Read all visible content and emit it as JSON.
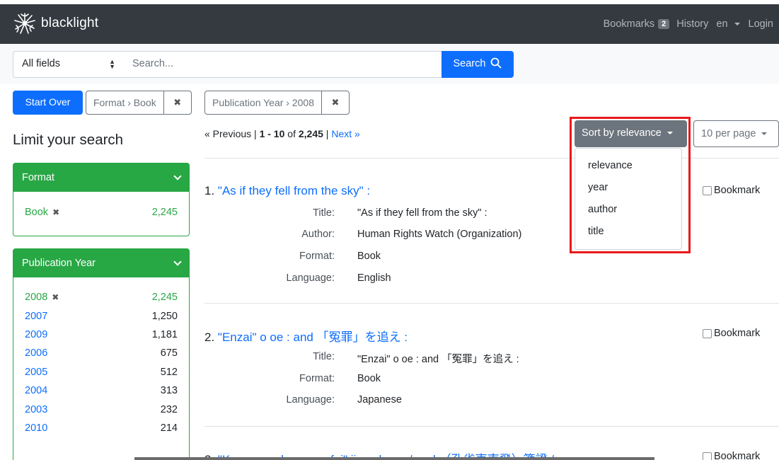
{
  "navbar": {
    "brand": "blacklight",
    "bookmarks_label": "Bookmarks",
    "bookmarks_count": "2",
    "history_label": "History",
    "language_label": "en",
    "login_label": "Login"
  },
  "search": {
    "field_selected": "All fields",
    "placeholder": "Search...",
    "button_label": "Search"
  },
  "constraints": {
    "start_over": "Start Over",
    "items": [
      {
        "label": "Format › Book",
        "remove": "✖"
      },
      {
        "label": "Publication Year › 2008",
        "remove": "✖"
      }
    ]
  },
  "sidebar": {
    "title": "Limit your search",
    "facets": [
      {
        "name": "Format",
        "items": [
          {
            "value": "Book",
            "count": "2,245",
            "selected": true
          }
        ]
      },
      {
        "name": "Publication Year",
        "items": [
          {
            "value": "2008",
            "count": "2,245",
            "selected": true
          },
          {
            "value": "2007",
            "count": "1,250"
          },
          {
            "value": "2009",
            "count": "1,181"
          },
          {
            "value": "2006",
            "count": "675"
          },
          {
            "value": "2005",
            "count": "512"
          },
          {
            "value": "2004",
            "count": "313"
          },
          {
            "value": "2003",
            "count": "232"
          },
          {
            "value": "2010",
            "count": "214"
          }
        ]
      }
    ]
  },
  "results_header": {
    "previous": "« Previous",
    "separator": "|",
    "range": "1 - 10",
    "of": "of",
    "total": "2,245",
    "next": "Next »",
    "sort_label": "Sort by relevance",
    "per_page_label": "10 per page",
    "sort_options": [
      "relevance",
      "year",
      "author",
      "title"
    ]
  },
  "results": [
    {
      "number": "1.",
      "title": "\"As if they fell from the sky\" :",
      "fields": [
        {
          "label": "Title:",
          "value": "\"As if they fell from the sky\" :"
        },
        {
          "label": "Author:",
          "value": "Human Rights Watch (Organization)"
        },
        {
          "label": "Format:",
          "value": "Book"
        },
        {
          "label": "Language:",
          "value": "English"
        }
      ],
      "bookmark": "Bookmark"
    },
    {
      "number": "2.",
      "title": "\"Enzai\" o oe : and 「冤罪」を追え :",
      "fields": [
        {
          "label": "Title:",
          "value": "\"Enzai\" o oe : and 「冤罪」を追え :"
        },
        {
          "label": "Format:",
          "value": "Book"
        },
        {
          "label": "Language:",
          "value": "Japanese"
        }
      ],
      "bookmark": "Bookmark"
    },
    {
      "number": "3.",
      "title": "\"Kong que dong nan fei\" jian zheng / and （孔雀東南飛）箋證 /",
      "fields": [],
      "bookmark": "Bookmark"
    }
  ]
}
